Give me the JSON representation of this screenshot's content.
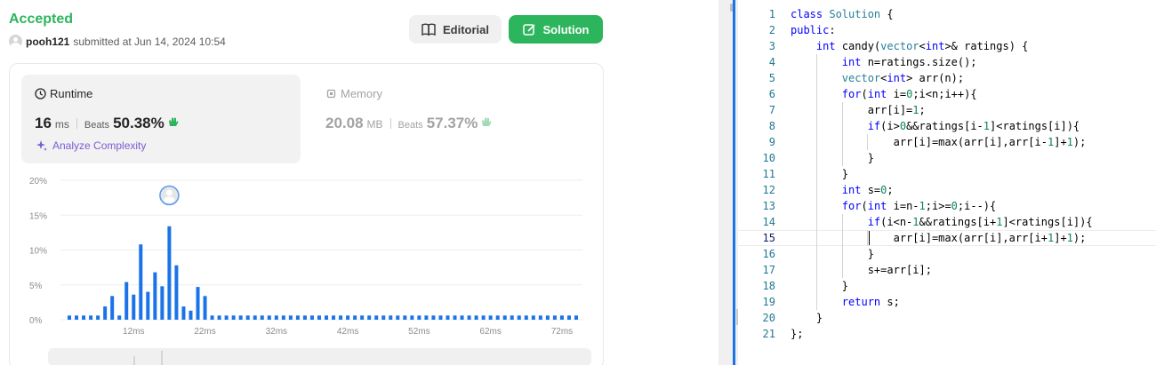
{
  "submission": {
    "status": "Accepted",
    "username": "pooh121",
    "submitted_text": "submitted at Jun 14, 2024 10:54"
  },
  "buttons": {
    "editorial": "Editorial",
    "solution": "Solution"
  },
  "colors": {
    "accepted": "#2db55d",
    "bar": "#1a73e8",
    "analyze": "#7a5cd6"
  },
  "runtime": {
    "label": "Runtime",
    "value": "16",
    "unit": "ms",
    "beats_label": "Beats",
    "beats_value": "50.38%",
    "analyze": "Analyze Complexity"
  },
  "memory": {
    "label": "Memory",
    "value": "20.08",
    "unit": "MB",
    "beats_label": "Beats",
    "beats_value": "57.37%"
  },
  "chart_data": {
    "type": "bar",
    "title": "",
    "xlabel": "",
    "ylabel": "",
    "ylim": [
      0,
      20
    ],
    "y_ticks": [
      "20%",
      "15%",
      "10%",
      "5%",
      "0%"
    ],
    "x_ticks": [
      "12ms",
      "22ms",
      "32ms",
      "42ms",
      "52ms",
      "62ms",
      "72ms"
    ],
    "x_range": [
      3,
      74
    ],
    "values": [
      0.6,
      0.6,
      0.6,
      0.6,
      0.6,
      1.9,
      3.4,
      0.6,
      5.4,
      3.6,
      10.8,
      4.0,
      6.8,
      4.8,
      13.4,
      7.8,
      1.9,
      1.3,
      4.7,
      3.4,
      0.6,
      0.6,
      0.6,
      0.6,
      0.6,
      0.6,
      0.6,
      0.6,
      0.6,
      0.6,
      0.6,
      0.6,
      0.6,
      0.6,
      0.6,
      0.6,
      0.6,
      0.6,
      0.6,
      0.6,
      0.6,
      0.6,
      0.6,
      0.6,
      0.6,
      0.6,
      0.6,
      0.6,
      0.6,
      0.6,
      0.6,
      0.6,
      0.6,
      0.6,
      0.6,
      0.6,
      0.6,
      0.6,
      0.6,
      0.6,
      0.6,
      0.6,
      0.6,
      0.6,
      0.6,
      0.6,
      0.6,
      0.6,
      0.6,
      0.6,
      0.6,
      0.6
    ],
    "highlight_index": 14,
    "grid": true
  },
  "code": {
    "lines": [
      "class Solution {",
      "public:",
      "    int candy(vector<int>& ratings) {",
      "        int n=ratings.size();",
      "        vector<int> arr(n);",
      "        for(int i=0;i<n;i++){",
      "            arr[i]=1;",
      "            if(i>0&&ratings[i-1]<ratings[i]){",
      "                arr[i]=max(arr[i],arr[i-1]+1);",
      "            }",
      "        }",
      "        int s=0;",
      "        for(int i=n-1;i>=0;i--){",
      "            if(i<n-1&&ratings[i+1]<ratings[i]){",
      "                arr[i]=max(arr[i],arr[i+1]+1);",
      "            }",
      "            s+=arr[i];",
      "        }",
      "        return s;",
      "    }",
      "};"
    ],
    "current_line": 15
  }
}
